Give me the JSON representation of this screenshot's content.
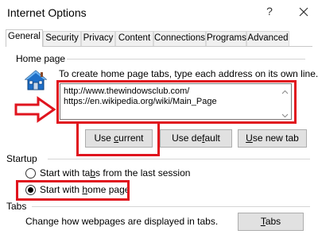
{
  "window": {
    "title": "Internet Options",
    "help_label": "?",
    "close_icon": "close-icon"
  },
  "tabs": [
    {
      "label": "General",
      "active": true
    },
    {
      "label": "Security",
      "active": false
    },
    {
      "label": "Privacy",
      "active": false
    },
    {
      "label": "Content",
      "active": false
    },
    {
      "label": "Connections",
      "active": false
    },
    {
      "label": "Programs",
      "active": false
    },
    {
      "label": "Advanced",
      "active": false
    }
  ],
  "home_page": {
    "heading": "Home page",
    "icon": "house-icon",
    "instruction": "To create home page tabs, type each address on its own line.",
    "urls": [
      "http://www.thewindowsclub.com/",
      "https://en.wikipedia.org/wiki/Main_Page"
    ],
    "buttons": {
      "use_current": {
        "pre": "Use ",
        "ul": "c",
        "post": "urrent"
      },
      "use_default": {
        "pre": "Use de",
        "ul": "f",
        "post": "ault"
      },
      "use_new_tab": {
        "pre": "",
        "ul": "U",
        "post": "se new tab"
      }
    }
  },
  "startup": {
    "heading": "Startup",
    "options": [
      {
        "pre": "Start with ta",
        "ul": "b",
        "post": "s from the last session",
        "selected": false
      },
      {
        "pre": "Start with ",
        "ul": "h",
        "post": "ome page",
        "selected": true
      }
    ]
  },
  "tabs_section": {
    "heading": "Tabs",
    "description": "Change how webpages are displayed in tabs.",
    "button": {
      "pre": "",
      "ul": "T",
      "post": "abs"
    }
  },
  "colors": {
    "highlight": "#e0141e",
    "button_bg": "#e1e1e1",
    "icon_blue": "#1e6fc8"
  }
}
